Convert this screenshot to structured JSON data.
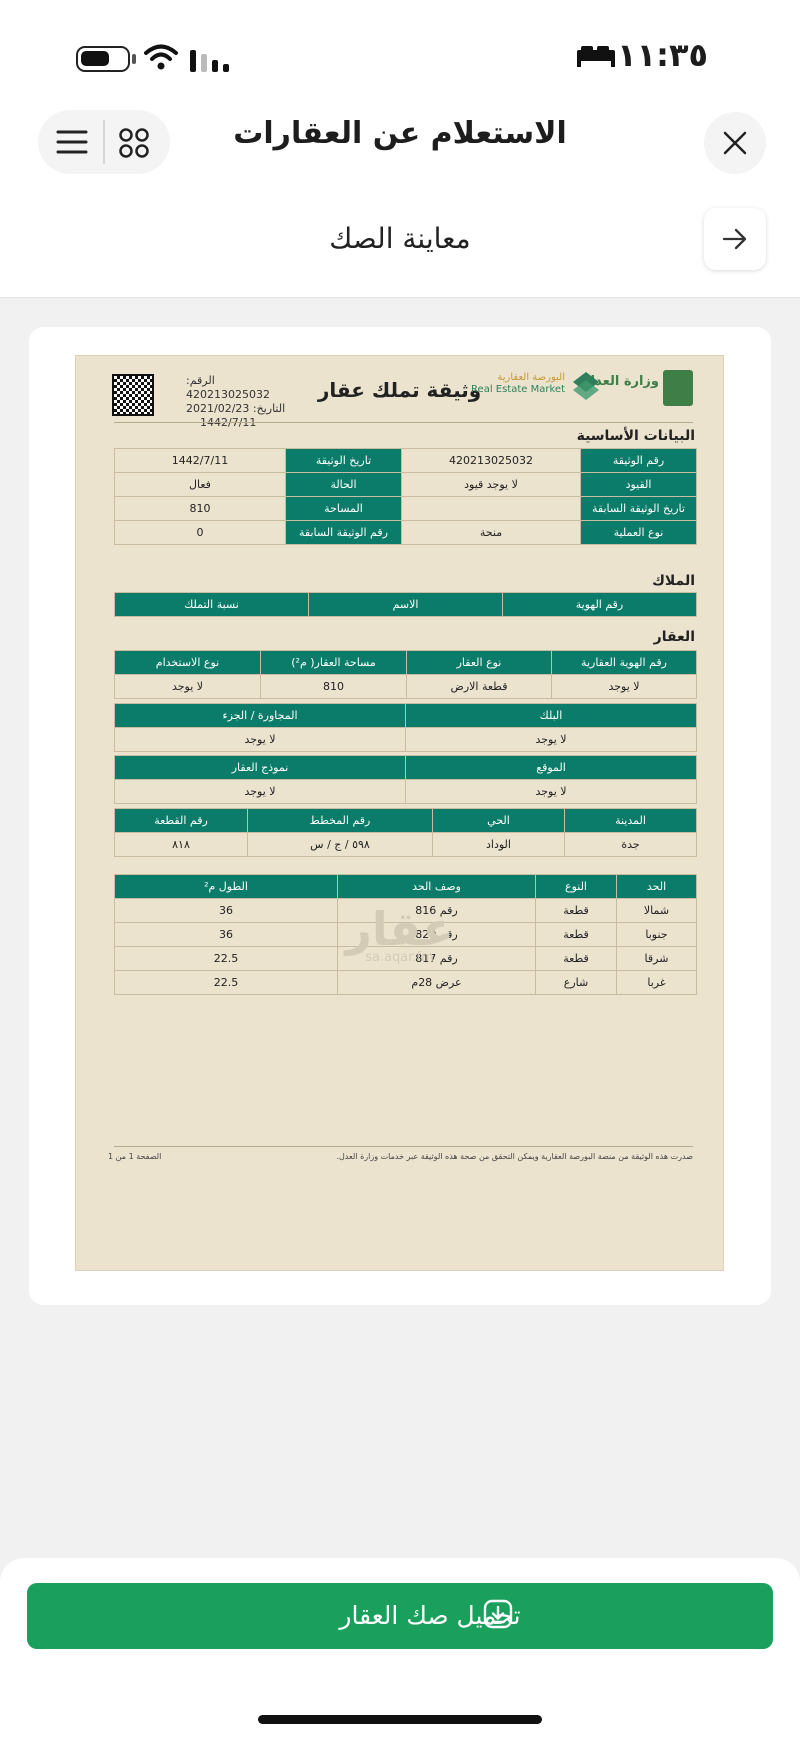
{
  "status_bar": {
    "time": "١١:٣٥"
  },
  "header": {
    "title": "الاستعلام عن العقارات",
    "subtitle": "معاينة الصك"
  },
  "document": {
    "title": "وثيقة تملك عقار",
    "meta": {
      "number": "الرقم: 420213025032",
      "date_g": "التاريخ: 2021/02/23",
      "date_h": "1442/7/11"
    },
    "logos": {
      "moj": "وزارة العدل",
      "market_ar": "البورصة العقارية",
      "market_en": "Real Estate Market"
    },
    "basic_section": "البيانات الأساسية",
    "basic_rows": [
      [
        "رقم الوثيقة",
        "420213025032",
        "تاريخ الوثيقة",
        "1442/7/11"
      ],
      [
        "القيود",
        "لا يوجد قيود",
        "الحالة",
        "فعال"
      ],
      [
        "تاريخ الوثيقة السابقة",
        "",
        "المساحة",
        "810"
      ],
      [
        "نوع العملية",
        "منحة",
        "رقم الوثيقة السابقة",
        "0"
      ]
    ],
    "owners_section": "الملاك",
    "owners_headers": [
      "رقم الهوية",
      "الاسم",
      "نسبة التملك"
    ],
    "property_section": "العقار",
    "prop_headers": [
      "رقم الهوية العقارية",
      "نوع العقار",
      "مساحة العقار( م²)",
      "نوع الاستخدام"
    ],
    "prop_values": [
      "لا يوجد",
      "قطعة الارض",
      "810",
      "لا يوجد"
    ],
    "pair_rows": [
      {
        "h1": "البلك",
        "h2": "المجاورة / الجزء",
        "v1": "لا يوجد",
        "v2": "لا يوجد"
      },
      {
        "h1": "الموقع",
        "h2": "نموذج العقار",
        "v1": "لا يوجد",
        "v2": "لا يوجد"
      }
    ],
    "loc_headers": [
      "المدينة",
      "الحي",
      "رقم المخطط",
      "رقم القطعة"
    ],
    "loc_values": [
      "جدة",
      "الوداد",
      "٥٩٨ / ج / س",
      "٨١٨"
    ],
    "bounds_headers": [
      "الحد",
      "النوع",
      "وصف الحد",
      "الطول م²"
    ],
    "bounds_rows": [
      [
        "شمالا",
        "قطعة",
        "رقم 816",
        "36"
      ],
      [
        "جنوبا",
        "قطعة",
        "رقم 820",
        "36"
      ],
      [
        "شرقا",
        "قطعة",
        "رقم 817",
        "22.5"
      ],
      [
        "غربا",
        "شارع",
        "عرض 28م",
        "22.5"
      ]
    ],
    "watermark": {
      "brand": "عقار",
      "handle": "sa.aqar.fm"
    },
    "footer_note": "صدرت هذه الوثيقة من منصة البورصة العقارية ويمكن التحقق من صحة هذه الوثيقة عبر خدمات وزارة العدل.",
    "footer_page": "الصفحة 1 من 1"
  },
  "download_button": {
    "label": "تحميل صك العقار"
  },
  "colors": {
    "table_header": "#0b7c69",
    "button": "#1b9f5c",
    "paper": "#ece3cf"
  }
}
